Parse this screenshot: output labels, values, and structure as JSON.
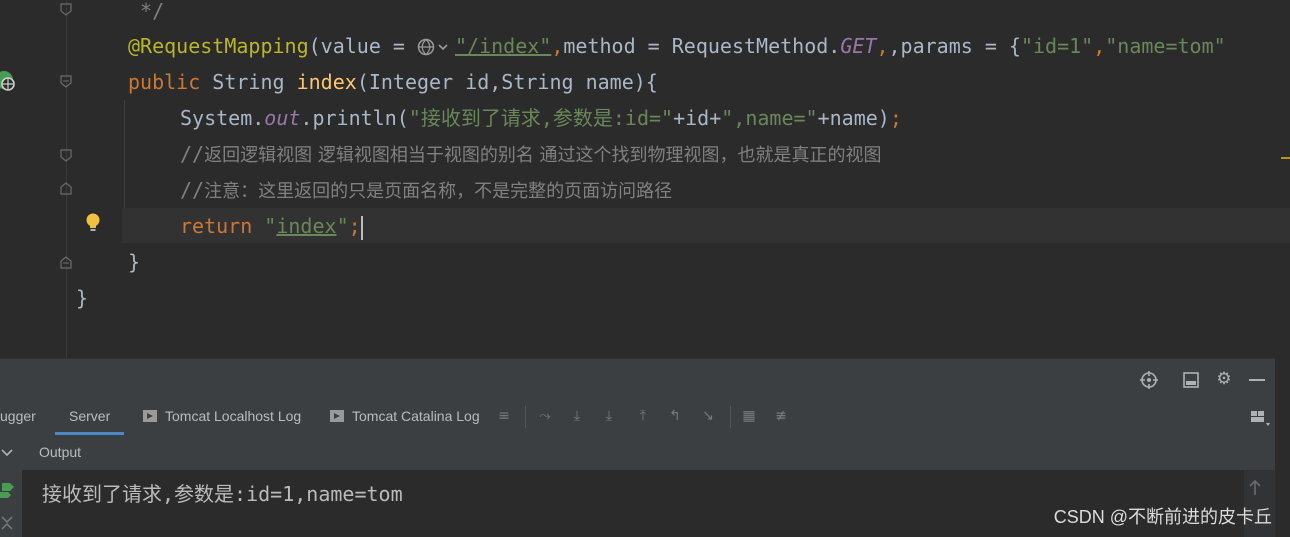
{
  "editor": {
    "lines": {
      "comment_end": " */",
      "annotation": "@RequestMapping",
      "open_value": "(value = ",
      "path": "\"/index\"",
      "comma": ",",
      "method_kw": "method = RequestMethod.",
      "method": "GET",
      "params_kw": ",params = {",
      "param1": "\"id=1\"",
      "param2": "\"name=tom\"",
      "public": "public ",
      "string_type": "String ",
      "method_name": "index",
      "signature": "(Integer id,String name){",
      "sys": "System.",
      "out": "out",
      "println": ".println(",
      "msg1": "\"接收到了请求,参数是:id=\"",
      "plus_id": "+id+",
      "msg2": "\",name=\"",
      "plus_name": "+name)",
      "semicolon": ";",
      "comment1_prefix": "//",
      "comment1": "返回逻辑视图 逻辑视图相当于视图的别名 通过这个找到物理视图，也就是真正的视图",
      "comment2_prefix": "//",
      "comment2": "注意：这里返回的只是页面名称，不是完整的页面访问路径",
      "return_kw": "return ",
      "return_q1": "\"",
      "return_val": "index",
      "return_q2": "\"",
      "close_method": "}",
      "close_class": "}"
    },
    "colors": {
      "keyword": "#cc7832",
      "annotation": "#bbb529",
      "string": "#6a8759",
      "function": "#ffc66d",
      "field": "#9876aa",
      "comment": "#808080"
    }
  },
  "panel": {
    "tabs": {
      "debugger": "ugger",
      "server": "Server",
      "tomcat_localhost": "Tomcat Localhost Log",
      "tomcat_catalina": "Tomcat Catalina Log"
    },
    "output_label": "Output",
    "output_text": "接收到了请求,参数是:id=1,name=tom"
  },
  "watermark": "CSDN @不断前进的皮卡丘"
}
